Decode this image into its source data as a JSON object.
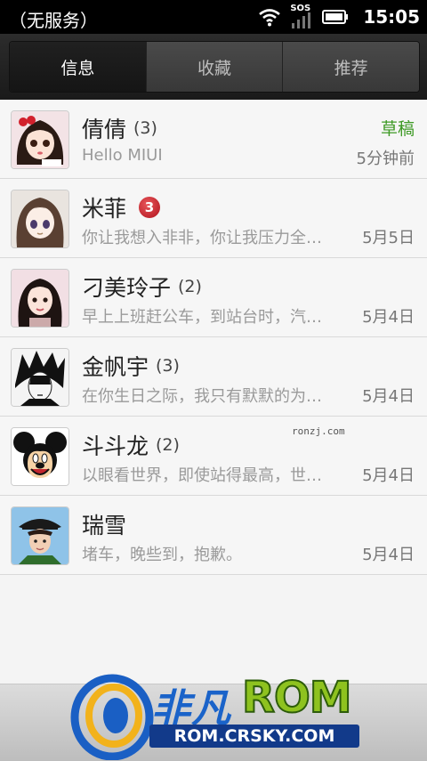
{
  "statusbar": {
    "carrier": "（无服务）",
    "sos": "SOS",
    "time": "15:05",
    "icons": [
      "wifi-icon",
      "signal-icon",
      "battery-icon"
    ]
  },
  "tabs": [
    {
      "label": "信息",
      "active": true
    },
    {
      "label": "收藏",
      "active": false
    },
    {
      "label": "推荐",
      "active": false
    }
  ],
  "conversations": [
    {
      "name": "倩倩",
      "count": "(3)",
      "preview": "Hello MIUI",
      "time": "5分钟前",
      "status": "草稿"
    },
    {
      "name": "米菲",
      "badge": "3",
      "preview": "你让我想入非非，你让我压力全…",
      "time": "5月5日"
    },
    {
      "name": "刁美玲子",
      "count": "(2)",
      "preview": "早上上班赶公车，到站台时，汽…",
      "time": "5月4日"
    },
    {
      "name": "金帆宇",
      "count": "(3)",
      "preview": "在你生日之际，我只有默默的为…",
      "time": "5月4日"
    },
    {
      "name": "斗斗龙",
      "count": "(2)",
      "preview": "以眼看世界，即使站得最高，世…",
      "time": "5月4日"
    },
    {
      "name": "瑞雪",
      "preview": "堵车，晚些到，抱歉。",
      "time": "5月4日"
    }
  ],
  "watermarks": {
    "small": "ronzj.com",
    "logo_cn": "非凡",
    "logo_rom": "ROM",
    "logo_url": "ROM.CRSKY.COM"
  },
  "colors": {
    "draft": "#3e9a25",
    "badge": "#c0202a",
    "tab_active_bg": "#1a1a1a"
  }
}
